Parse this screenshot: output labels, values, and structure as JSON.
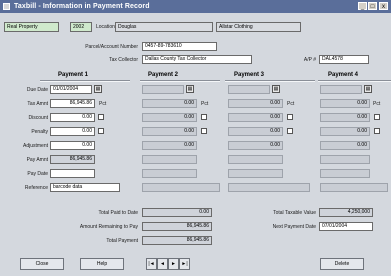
{
  "window": {
    "title": "Taxbill - Information in Payment Record",
    "min": "_",
    "max": "□",
    "close": "x"
  },
  "header": {
    "type": "Real Property",
    "year": "2002",
    "location_label": "Location",
    "location": "Douglas",
    "owner": "Allstar Clothing"
  },
  "parcel": {
    "label": "Parcel/Account Number",
    "value": "0457-89-783610"
  },
  "collector": {
    "label": "Tax Collector",
    "value": "Dallas County Tax Collector"
  },
  "ap": {
    "label": "A/P #",
    "value": "DAL4578"
  },
  "payments_titles": [
    "Payment 1",
    "Payment 2",
    "Payment 3",
    "Payment 4"
  ],
  "row_labels": {
    "due_date": "Due Date",
    "tax_amount": "Tax Amnt",
    "discount": "Discount",
    "penalty": "Penalty",
    "adjustment": "Adjustment",
    "pay_amount": "Pay Amnt",
    "pay_date": "Pay Date",
    "reference": "Reference"
  },
  "pct_label": "Pct",
  "payment1": {
    "due_date": "01/01/2004",
    "tax_amount": "86,945.86",
    "discount": "0.00",
    "penalty": "0.00",
    "adjustment": "0.00",
    "pay_amount": "86,945.86",
    "reference": "barcode data"
  },
  "payment2": {
    "tax_amount": "0.00",
    "discount": "0.00",
    "penalty": "0.00",
    "adjustment": "0.00"
  },
  "payment3": {
    "tax_amount": "0.00",
    "discount": "0.00",
    "penalty": "0.00",
    "adjustment": "0.00"
  },
  "payment4": {
    "tax_amount": "0.00",
    "discount": "0.00",
    "penalty": "0.00",
    "adjustment": "0.00"
  },
  "totals": {
    "paid_label": "Total Paid to Date",
    "paid": "0.00",
    "remaining_label": "Amount Remaining to Pay",
    "remaining": "86,945.86",
    "total_payment_label": "Total Payment",
    "total_payment": "86,945.86",
    "taxable_label": "Total Taxable Value",
    "taxable": "4,250,000",
    "next_label": "Next Payment Date",
    "next": "07/01/2004"
  },
  "buttons": {
    "close": "Close",
    "help": "Help",
    "delete": "Delete"
  },
  "nav": {
    "first": "|◄",
    "prev": "◄",
    "next": "►",
    "last": "►|"
  },
  "icons": {
    "calendar": "calendar-icon",
    "checkbox": "checkbox"
  }
}
